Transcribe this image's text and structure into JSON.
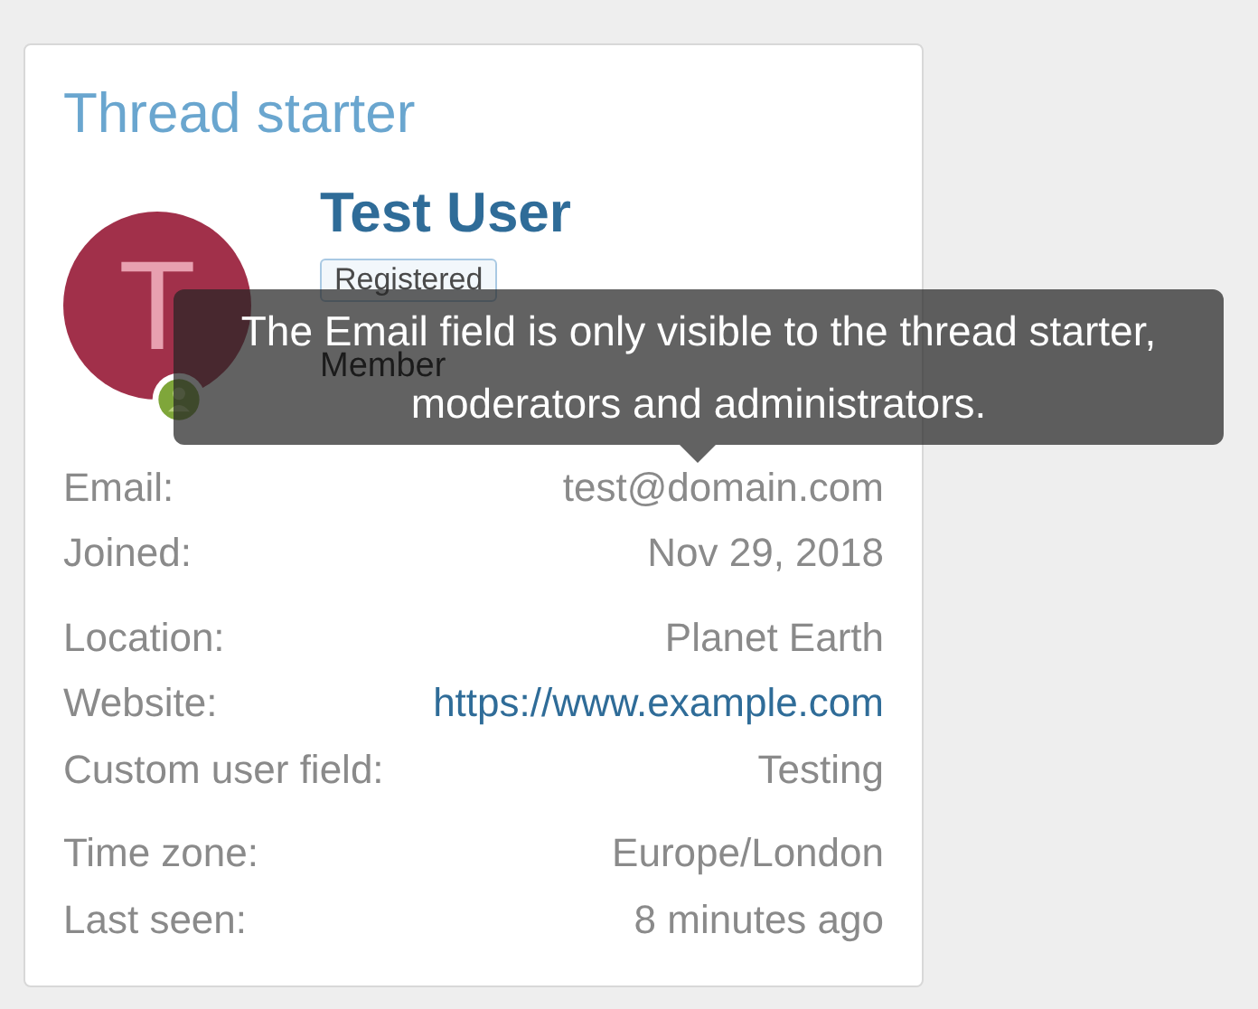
{
  "card": {
    "title": "Thread starter"
  },
  "user": {
    "avatar_letter": "T",
    "online": true,
    "name": "Test User",
    "badge": "Registered",
    "title": "Member"
  },
  "tooltip": {
    "text": "The Email field is only visible to the thread starter, moderators and administrators."
  },
  "groups": [
    [
      {
        "label": "Email:",
        "value": "test@domain.com",
        "kind": "text"
      },
      {
        "label": "Joined:",
        "value": "Nov 29, 2018",
        "kind": "text"
      }
    ],
    [
      {
        "label": "Location:",
        "value": "Planet Earth",
        "kind": "text"
      },
      {
        "label": "Website:",
        "value": "https://www.example.com",
        "kind": "link"
      },
      {
        "label": "Custom user field:",
        "value": "Testing",
        "kind": "text"
      }
    ],
    [
      {
        "label": "Time zone:",
        "value": "Europe/London",
        "kind": "text"
      },
      {
        "label": "Last seen:",
        "value": "8 minutes ago",
        "kind": "text"
      }
    ]
  ]
}
